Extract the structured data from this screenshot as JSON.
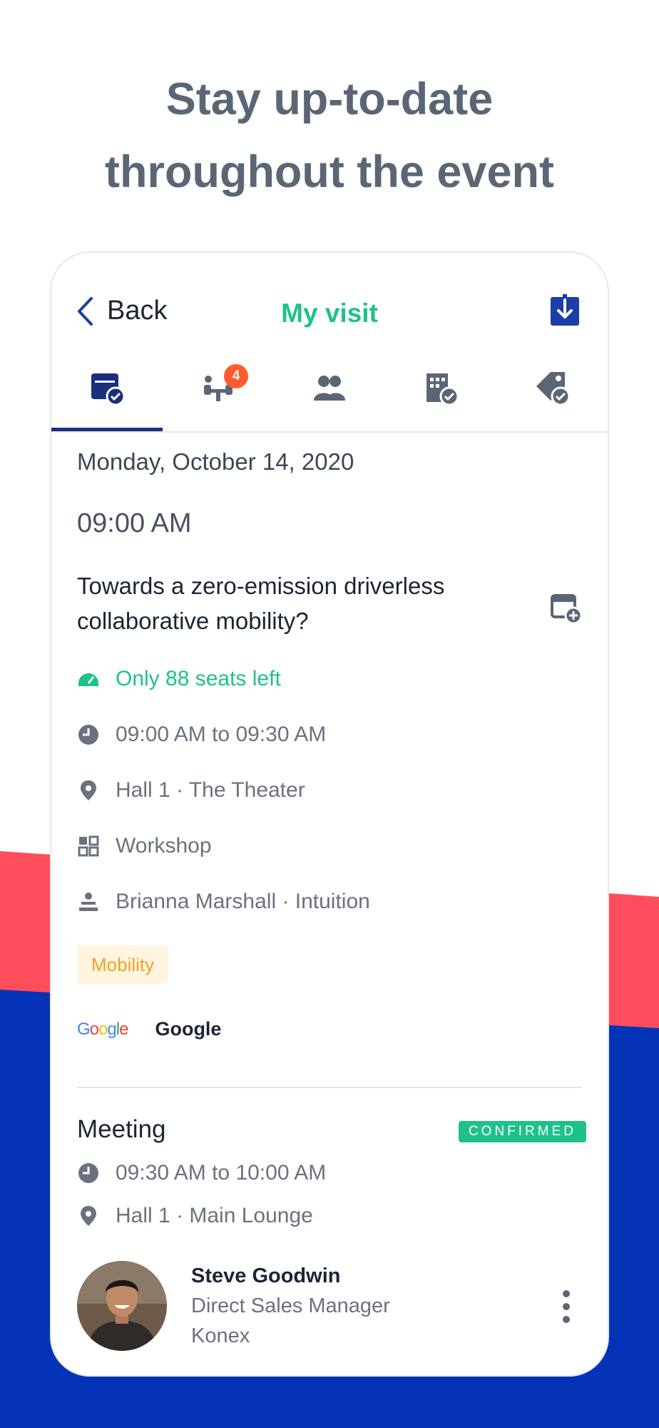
{
  "headline": {
    "line1": "Stay up-to-date",
    "line2": "throughout the event"
  },
  "header": {
    "back_label": "Back",
    "title": "My visit"
  },
  "tabs": [
    {
      "icon": "calendar-check-icon",
      "active": true
    },
    {
      "icon": "meeting-people-icon",
      "badge": "4"
    },
    {
      "icon": "contacts-icon"
    },
    {
      "icon": "building-check-icon"
    },
    {
      "icon": "tag-check-icon"
    }
  ],
  "session": {
    "date": "Monday, October 14, 2020",
    "time": "09:00 AM",
    "title": "Towards a zero-emission driverless collaborative mobility?",
    "seats": "Only 88 seats left",
    "time_range": "09:00 AM to 09:30 AM",
    "location": "Hall 1 · The Theater",
    "format": "Workshop",
    "speaker": "Brianna Marshall · Intuition",
    "tag": "Mobility",
    "sponsor_logo": "Google",
    "sponsor_name": "Google"
  },
  "meeting": {
    "title": "Meeting",
    "status": "CONFIRMED",
    "time_range": "09:30 AM to 10:00 AM",
    "location": "Hall 1 · Main Lounge",
    "person": {
      "name": "Steve Goodwin",
      "role": "Direct Sales Manager",
      "company": "Konex"
    }
  },
  "colors": {
    "accent_green": "#1fc18b",
    "navy": "#1a2f7d",
    "red_wave": "#ff4d5c",
    "blue_wave": "#0433b8",
    "tag_bg": "#fff5e1",
    "tag_text": "#efa321"
  }
}
